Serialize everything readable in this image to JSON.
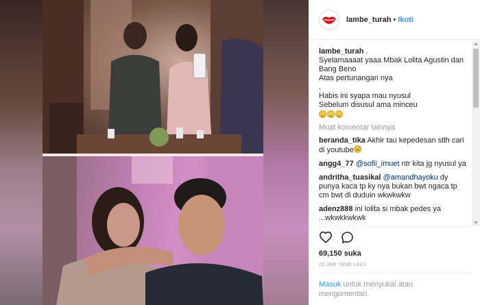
{
  "header": {
    "username": "lambe_turah",
    "separator": "•",
    "follow_label": "Ikuti"
  },
  "caption": {
    "username": "lambe_turah",
    "lines": [
      ".",
      "Syelamaaaat yaaa Mbak Lolita Agustin dan",
      "Bang Beno",
      "Atas pertunangan nya",
      ".",
      "Habis ini syapa mau nyusul",
      "Sebelum disusul ama minceu"
    ]
  },
  "load_more_label": "Muat komentar lainnya",
  "comments": [
    {
      "username": "beranda_tika",
      "lines": [
        "Akhir tau kepedesan stlh cari",
        "di youtube"
      ],
      "mention": ""
    },
    {
      "username": "angg4_77",
      "mention": "@sofii_imuet",
      "lines": [
        "ntr kita jg nyusul ya"
      ]
    },
    {
      "username": "andritha_tuasikal",
      "mention": "@amandhayoku",
      "lines": [
        "dy",
        "punya kaca tp ky nya bukan bwt ngaca tp",
        "cm bwt di duduin wkwkwkw"
      ]
    },
    {
      "username": "adenz888",
      "mention": "",
      "lines": [
        "ini lolita si mbak pedes ya",
        "...wkwkkwkwk"
      ]
    }
  ],
  "icons": {
    "like": "heart-icon",
    "comment": "comment-bubble-icon",
    "avatar": "lips-logo-icon"
  },
  "likes_text": "69,150 suka",
  "time_text": "20 JAM YANG LALU",
  "footer": {
    "login_label": "Masuk",
    "rest_line1": "untuk menyukai atau",
    "rest_line2": "mengomentari."
  },
  "colors": {
    "link": "#3897f0",
    "muted": "#999999",
    "text": "#262626"
  }
}
